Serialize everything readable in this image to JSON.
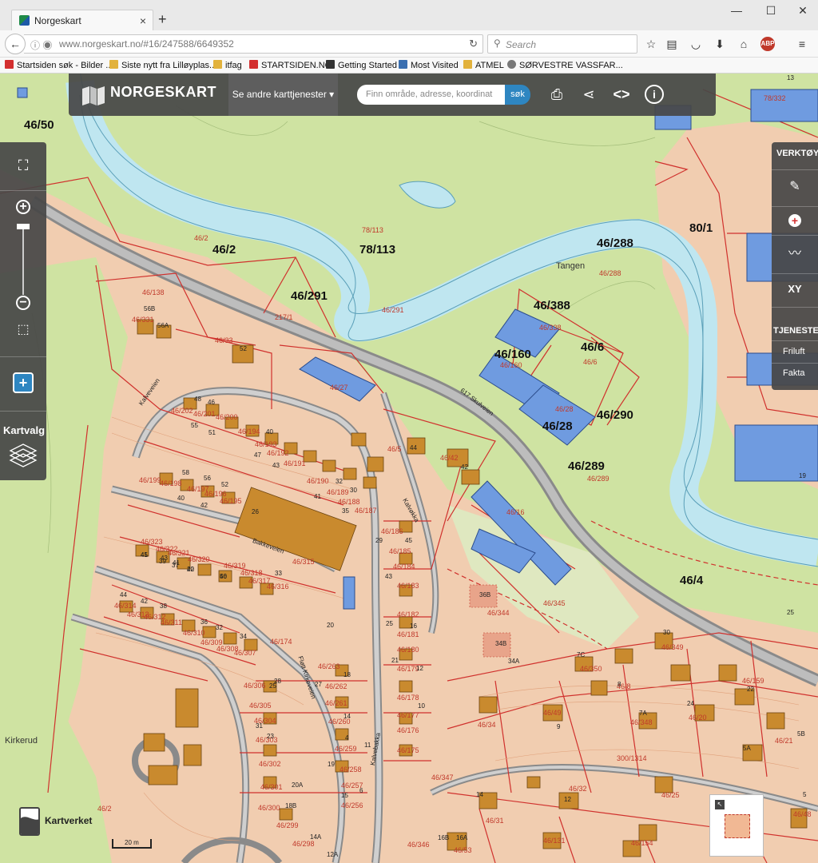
{
  "browser": {
    "tab_title": "Norgeskart",
    "tab_close": "×",
    "new_tab": "+",
    "url": "www.norgeskart.no/#16/247588/6649352",
    "search_placeholder": "Search",
    "bookmarks": [
      "Startsiden søk - Bilder ...",
      "Siste nytt fra Lilløyplas...",
      "itfag",
      "STARTSIDEN.NO",
      "Getting Started",
      "Most Visited",
      "ATMEL",
      "SØRVESTRE VASSFAR..."
    ]
  },
  "app": {
    "logo": "NORGESKART",
    "services_button": "Se andre karttjenester ▾",
    "search_placeholder": "Finn område, adresse, koordinat",
    "search_button": "søk",
    "left_panel": {
      "kartvalg": "Kartvalg"
    },
    "right_panel": {
      "verktoy": "VERKTØY",
      "xy": "XY",
      "tjenester": "TJENESTER",
      "friluft": "Friluft",
      "fakta": "Fakta"
    },
    "kartverket": "Kartverket",
    "scale": "20 m"
  },
  "map": {
    "parcels_large": [
      "46/50",
      "46/2",
      "78/113",
      "46/288",
      "80/1",
      "46/291",
      "46/388",
      "46/6",
      "46/160",
      "46/28",
      "46/290",
      "46/289",
      "46/4"
    ],
    "parcels_small": [
      "78/113",
      "46/2",
      "46/291",
      "46/288",
      "46/338",
      "46/6",
      "46/160",
      "46/28",
      "46/289",
      "46/138",
      "46/331",
      "217/1",
      "46/33",
      "46/27",
      "46/202",
      "46/201",
      "46/200",
      "46/194",
      "46/193",
      "46/192",
      "46/191",
      "46/199",
      "46/198",
      "46/197",
      "46/196",
      "46/195",
      "46/190",
      "46/189",
      "46/188",
      "46/187",
      "46/5",
      "46/42",
      "46/16",
      "46/186",
      "46/185",
      "46/184",
      "46/183",
      "46/323",
      "46/322",
      "46/321",
      "46/320",
      "46/319",
      "46/318",
      "46/317",
      "46/316",
      "46/315",
      "46/314",
      "46/313",
      "46/312",
      "46/311",
      "46/310",
      "46/309",
      "46/308",
      "46/307",
      "46/174",
      "46/182",
      "46/181",
      "46/180",
      "46/179",
      "46/344",
      "46/345",
      "46/263",
      "46/262",
      "46/261",
      "46/260",
      "46/259",
      "46/258",
      "46/257",
      "46/256",
      "46/306",
      "46/305",
      "46/304",
      "46/303",
      "46/302",
      "46/301",
      "46/300",
      "46/299",
      "46/298",
      "46/178",
      "46/177",
      "46/176",
      "46/175",
      "46/350",
      "46/349",
      "46/8",
      "46/348",
      "46/159",
      "46/20",
      "46/21",
      "46/34",
      "46/49",
      "300/1314",
      "46/347",
      "46/32",
      "46/31",
      "46/25",
      "46/48",
      "46/346",
      "46/53",
      "46/131",
      "46/154",
      "78/332",
      "46/2"
    ],
    "road_labels": [
      "617 Skulveien",
      "Kalveveien",
      "Bakkeveien",
      "Kalvebakka",
      "Fløtt Kirkeveien",
      "Kalvøkka"
    ],
    "place_names": [
      "Tangen",
      "Kirkerud"
    ],
    "house_numbers": [
      "13",
      "19",
      "56B",
      "56A",
      "52",
      "48",
      "46",
      "55",
      "51",
      "40",
      "47",
      "43",
      "58",
      "56",
      "52",
      "40",
      "42",
      "32",
      "30",
      "41",
      "35",
      "44",
      "42",
      "45",
      "43",
      "41",
      "40",
      "50",
      "33",
      "26",
      "29",
      "45",
      "43",
      "41",
      "39",
      "37",
      "22",
      "46",
      "44",
      "42",
      "38",
      "36",
      "32",
      "34",
      "28",
      "25",
      "16",
      "21",
      "12",
      "10",
      "20",
      "18",
      "14",
      "36B",
      "34B",
      "34A",
      "7C",
      "30",
      "22",
      "24",
      "7A",
      "5B",
      "5A",
      "20A",
      "18B",
      "14A",
      "12A",
      "15",
      "6",
      "4",
      "11",
      "9",
      "8",
      "27",
      "25",
      "23",
      "31",
      "19",
      "16A",
      "16B",
      "14",
      "12",
      "25",
      "5"
    ]
  }
}
